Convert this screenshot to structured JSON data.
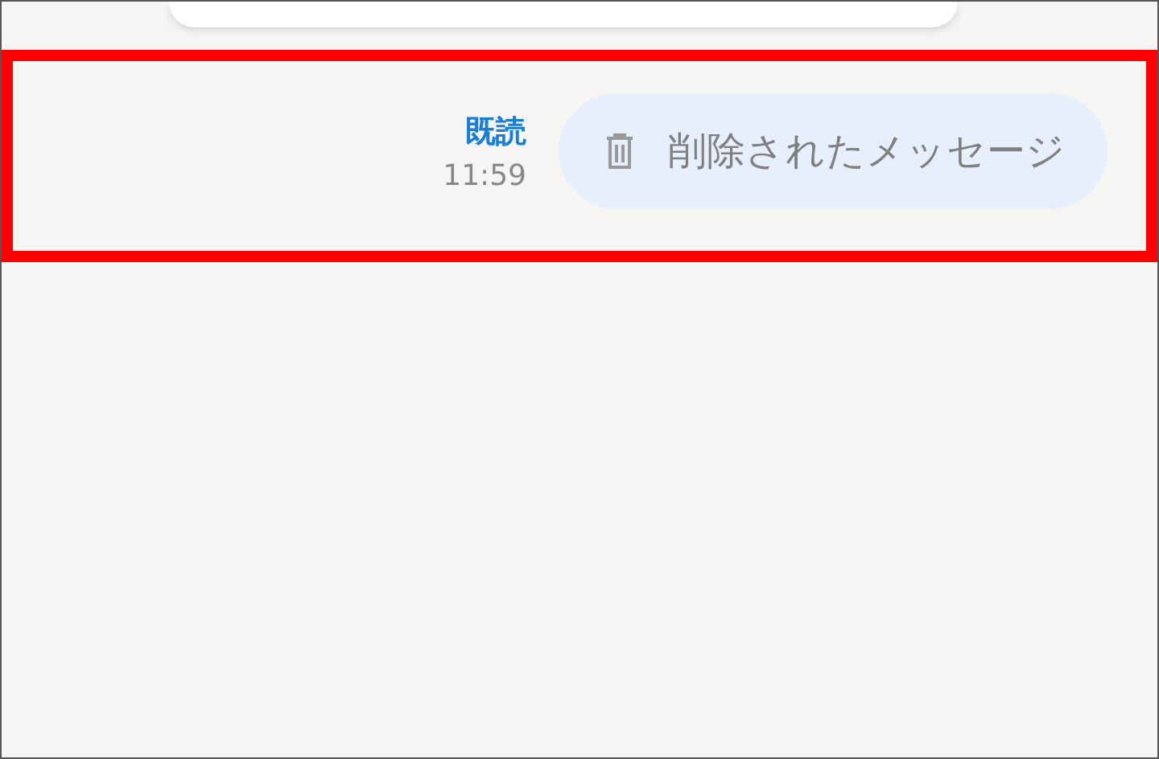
{
  "messages": [
    {
      "kind": "partial"
    },
    {
      "kind": "deleted",
      "highlighted": true,
      "read_label": "既読",
      "time": "11:59",
      "text": "削除されたメッセージ"
    }
  ]
}
